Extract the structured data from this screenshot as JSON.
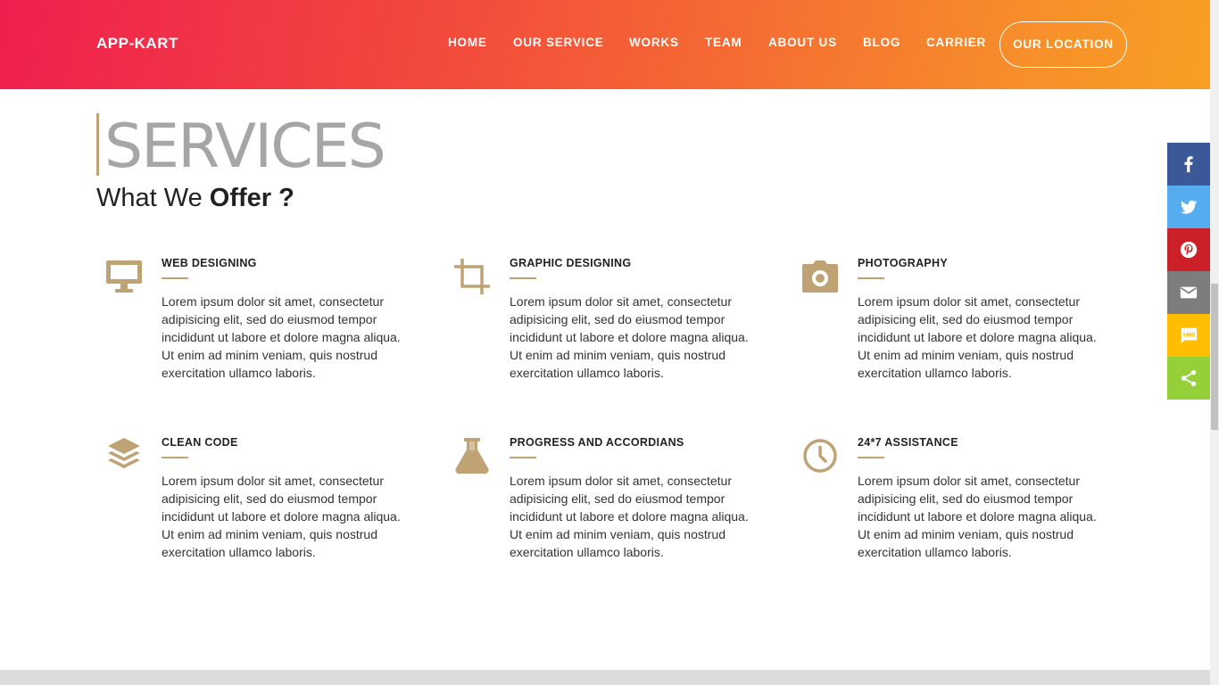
{
  "brand": "APP-KART",
  "nav": {
    "items": [
      "HOME",
      "OUR SERVICE",
      "WORKS",
      "TEAM",
      "ABOUT US",
      "BLOG",
      "CARRIER"
    ],
    "cta": "OUR LOCATION"
  },
  "section": {
    "title": "SERVICES",
    "subtitle_prefix": "What We ",
    "subtitle_bold": "Offer ?"
  },
  "services": [
    {
      "icon": "monitor-icon",
      "title": "WEB DESIGNING",
      "text": "Lorem ipsum dolor sit amet, consectetur adipisicing elit, sed do eiusmod tempor incididunt ut labore et dolore magna aliqua. Ut enim ad minim veniam, quis nostrud exercitation ullamco laboris."
    },
    {
      "icon": "crop-icon",
      "title": "GRAPHIC DESIGNING",
      "text": "Lorem ipsum dolor sit amet, consectetur adipisicing elit, sed do eiusmod tempor incididunt ut labore et dolore magna aliqua. Ut enim ad minim veniam, quis nostrud exercitation ullamco laboris."
    },
    {
      "icon": "camera-icon",
      "title": "PHOTOGRAPHY",
      "text": "Lorem ipsum dolor sit amet, consectetur adipisicing elit, sed do eiusmod tempor incididunt ut labore et dolore magna aliqua. Ut enim ad minim veniam, quis nostrud exercitation ullamco laboris."
    },
    {
      "icon": "layers-icon",
      "title": "CLEAN CODE",
      "text": "Lorem ipsum dolor sit amet, consectetur adipisicing elit, sed do eiusmod tempor incididunt ut labore et dolore magna aliqua. Ut enim ad minim veniam, quis nostrud exercitation ullamco laboris."
    },
    {
      "icon": "flask-icon",
      "title": "PROGRESS AND ACCORDIANS",
      "text": "Lorem ipsum dolor sit amet, consectetur adipisicing elit, sed do eiusmod tempor incididunt ut labore et dolore magna aliqua. Ut enim ad minim veniam, quis nostrud exercitation ullamco laboris."
    },
    {
      "icon": "clock-icon",
      "title": "24*7 ASSISTANCE",
      "text": "Lorem ipsum dolor sit amet, consectetur adipisicing elit, sed do eiusmod tempor incididunt ut labore et dolore magna aliqua. Ut enim ad minim veniam, quis nostrud exercitation ullamco laboris."
    }
  ],
  "share": [
    {
      "icon": "facebook-icon",
      "color": "#3b5998"
    },
    {
      "icon": "twitter-icon",
      "color": "#55acee"
    },
    {
      "icon": "pinterest-icon",
      "color": "#cb2027"
    },
    {
      "icon": "email-icon",
      "color": "#7d7d7d"
    },
    {
      "icon": "sms-icon",
      "color": "#ffbd00"
    },
    {
      "icon": "share-icon",
      "color": "#95d03a"
    }
  ],
  "colors": {
    "accent": "#c0a375",
    "gradient_start": "#ef1f4f",
    "gradient_end": "#f8a023"
  }
}
